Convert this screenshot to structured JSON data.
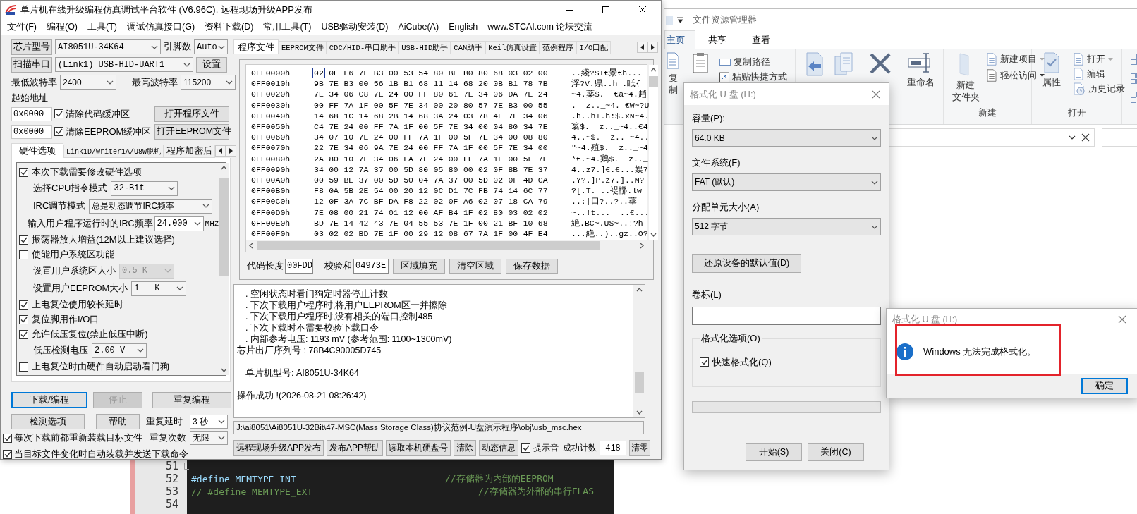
{
  "stc_window": {
    "title": "单片机在线升级编程仿真调试平台软件 (V6.96C), 远程现场升级APP发布",
    "menu": [
      "文件(F)",
      "编程(O)",
      "工具(T)",
      "调试仿真接口(G)",
      "资料下载(D)",
      "常用工具(T)",
      "USB驱动安装(D)",
      "AiCube(A)",
      "English",
      "www.STCAI.com 论坛交流"
    ],
    "chip_row": {
      "button": "芯片型号",
      "chip": "AI8051U-34K64",
      "pins_label": "引脚数",
      "pins": "Auto"
    },
    "port_row": {
      "button": "扫描串口",
      "port": "(Link1) USB-HID-UART1",
      "settings": "设置"
    },
    "baud_row": {
      "min_label": "最低波特率",
      "min": "2400",
      "max_label": "最高波特率",
      "max": "115200"
    },
    "start_address_label": "起始地址",
    "buffers": [
      {
        "address": "0x0000",
        "label": "清除代码缓冲区",
        "checked": true,
        "button": "打开程序文件"
      },
      {
        "address": "0x0000",
        "label": "清除EEPROM缓冲区",
        "checked": true,
        "button": "打开EEPROM文件"
      }
    ],
    "option_tabs": [
      {
        "label": "硬件选项",
        "selected": true
      },
      {
        "label": "Link1D/Writer1A/U8W脱机",
        "selected": false
      },
      {
        "label": "程序加密后",
        "selected": false
      }
    ],
    "hardware_options": [
      {
        "kind": "check",
        "label": "本次下载需要修改硬件选项",
        "checked": true
      },
      {
        "kind": "select",
        "label": "选择CPU指令模式",
        "value": "32-Bit",
        "disabled": false
      },
      {
        "kind": "select",
        "label": "IRC调节模式",
        "value": "总是动态调节IRC频率",
        "disabled": false
      },
      {
        "kind": "input",
        "label": "输入用户程序运行时的IRC频率",
        "value": "24.000",
        "unit": "MHz"
      },
      {
        "kind": "check",
        "label": "振荡器放大增益(12M以上建议选择)",
        "checked": true
      },
      {
        "kind": "check",
        "label": "使能用户系统区功能",
        "checked": false
      },
      {
        "kind": "select",
        "label": "设置用户系统区大小",
        "value": "0.5 K",
        "disabled": true
      },
      {
        "kind": "select",
        "label": "设置用户EEPROM大小",
        "value": "1   K",
        "disabled": false
      },
      {
        "kind": "check",
        "label": "上电复位使用较长延时",
        "checked": true
      },
      {
        "kind": "check",
        "label": "复位脚用作I/O口",
        "checked": true
      },
      {
        "kind": "check",
        "label": "允许低压复位(禁止低压中断)",
        "checked": true
      },
      {
        "kind": "select",
        "label": "低压检测电压",
        "value": "2.00 V",
        "disabled": false
      },
      {
        "kind": "check",
        "label": "上电复位时由硬件自动启动看门狗",
        "checked": false
      }
    ],
    "action_buttons": [
      {
        "label": "下载/编程",
        "focused": true,
        "disabled": false
      },
      {
        "label": "停止",
        "focused": false,
        "disabled": true
      },
      {
        "label": "重复编程",
        "focused": false,
        "disabled": false
      }
    ],
    "detect_button": "检测选项",
    "help_button": "帮助",
    "repeat_delay": {
      "label": "重复延时",
      "value": "3 秒"
    },
    "repeat_count": {
      "label": "重复次数",
      "value": "无限"
    },
    "reload_options": [
      {
        "label": "每次下载前都重新装载目标文件",
        "checked": true
      },
      {
        "label": "当目标文件变化时自动装载并发送下载命令",
        "checked": true
      }
    ],
    "file_tabs": [
      {
        "label": "程序文件",
        "selected": true
      },
      {
        "label": "EEPROM文件",
        "selected": false
      },
      {
        "label": "CDC/HID-串口助手",
        "selected": false
      },
      {
        "label": "USB-HID助手",
        "selected": false
      },
      {
        "label": "CAN助手",
        "selected": false
      },
      {
        "label": "Keil仿真设置",
        "selected": false
      },
      {
        "label": "范例程序",
        "selected": false
      },
      {
        "label": "I/O口配",
        "selected": false
      }
    ],
    "hex_view": {
      "rows": [
        {
          "address": "0FF0000h",
          "bytes": [
            "02",
            "0E",
            "E6",
            "7E",
            "B3",
            "00",
            "53",
            "54",
            "80",
            "BE",
            "B0",
            "80",
            "68",
            "03",
            "02",
            "00"
          ],
          "ascii": "..綫?ST€景€h...",
          "cursor": true
        },
        {
          "address": "0FF0010h",
          "bytes": [
            "9B",
            "7E",
            "B3",
            "00",
            "56",
            "1B",
            "B1",
            "68",
            "11",
            "14",
            "68",
            "20",
            "0B",
            "B1",
            "78",
            "7B"
          ],
          "ascii": "浮?V.県..h .眂{",
          "cursor": false
        },
        {
          "address": "0FF0020h",
          "bytes": [
            "7E",
            "34",
            "06",
            "C8",
            "7E",
            "24",
            "00",
            "FF",
            "80",
            "61",
            "7E",
            "34",
            "06",
            "DA",
            "7E",
            "24"
          ],
          "ascii": "~4.薬$.  €a~4.趙",
          "cursor": false
        },
        {
          "address": "0FF0030h",
          "bytes": [
            "00",
            "FF",
            "7A",
            "1F",
            "00",
            "5F",
            "7E",
            "34",
            "00",
            "20",
            "80",
            "57",
            "7E",
            "B3",
            "00",
            "55"
          ],
          "ascii": ".  z.._~4. €W~?U",
          "cursor": false
        },
        {
          "address": "0FF0040h",
          "bytes": [
            "14",
            "68",
            "1C",
            "14",
            "68",
            "2B",
            "14",
            "68",
            "3A",
            "24",
            "03",
            "78",
            "4E",
            "7E",
            "34",
            "06"
          ],
          "ascii": ".h..h+.h:$.xN~4.",
          "cursor": false
        },
        {
          "address": "0FF0050h",
          "bytes": [
            "C4",
            "7E",
            "24",
            "00",
            "FF",
            "7A",
            "1F",
            "00",
            "5F",
            "7E",
            "34",
            "00",
            "04",
            "80",
            "34",
            "7E"
          ],
          "ascii": "篘$.  z.._~4..€4",
          "cursor": false
        },
        {
          "address": "0FF0060h",
          "bytes": [
            "34",
            "07",
            "10",
            "7E",
            "24",
            "00",
            "FF",
            "7A",
            "1F",
            "00",
            "5F",
            "7E",
            "34",
            "00",
            "08",
            "80"
          ],
          "ascii": "4..~$.  z.._~4..",
          "cursor": false
        },
        {
          "address": "0FF0070h",
          "bytes": [
            "22",
            "7E",
            "34",
            "06",
            "9A",
            "7E",
            "24",
            "00",
            "FF",
            "7A",
            "1F",
            "00",
            "5F",
            "7E",
            "34",
            "00"
          ],
          "ascii": "\"~4.殖$.  z.._~4",
          "cursor": false
        },
        {
          "address": "0FF0080h",
          "bytes": [
            "2A",
            "80",
            "10",
            "7E",
            "34",
            "06",
            "FA",
            "7E",
            "24",
            "00",
            "FF",
            "7A",
            "1F",
            "00",
            "5F",
            "7E"
          ],
          "ascii": "*€.~4.鶏$.  z.._",
          "cursor": false
        },
        {
          "address": "0FF0090h",
          "bytes": [
            "34",
            "00",
            "12",
            "7A",
            "37",
            "00",
            "5D",
            "80",
            "05",
            "80",
            "00",
            "02",
            "0F",
            "8B",
            "7E",
            "37"
          ],
          "ascii": "4..z7.]€.€...娱7",
          "cursor": false
        },
        {
          "address": "0FF00A0h",
          "bytes": [
            "00",
            "59",
            "BE",
            "37",
            "00",
            "5D",
            "50",
            "04",
            "7A",
            "37",
            "00",
            "5D",
            "02",
            "0F",
            "4D",
            "CA"
          ],
          "ascii": ".Y?.]P.z7.]..M?",
          "cursor": false
        },
        {
          "address": "0FF00B0h",
          "bytes": [
            "F8",
            "0A",
            "5B",
            "2E",
            "54",
            "00",
            "20",
            "12",
            "0C",
            "D1",
            "7C",
            "FB",
            "74",
            "14",
            "6C",
            "77"
          ],
          "ascii": "?[.T. ..褆鞹.lw",
          "cursor": false
        },
        {
          "address": "0FF00C0h",
          "bytes": [
            "12",
            "0F",
            "3A",
            "7C",
            "BF",
            "DA",
            "F8",
            "22",
            "02",
            "0F",
            "A6",
            "02",
            "07",
            "18",
            "CA",
            "79"
          ],
          "ascii": "..:|口?..?..蕐",
          "cursor": false
        },
        {
          "address": "0FF00D0h",
          "bytes": [
            "7E",
            "08",
            "00",
            "21",
            "74",
            "01",
            "12",
            "00",
            "AF",
            "B4",
            "1F",
            "02",
            "80",
            "03",
            "02",
            "02"
          ],
          "ascii": "~..!t...  ..€...",
          "cursor": false
        },
        {
          "address": "0FF00E0h",
          "bytes": [
            "BD",
            "7E",
            "14",
            "42",
            "43",
            "7E",
            "04",
            "55",
            "53",
            "7E",
            "1F",
            "00",
            "21",
            "BF",
            "10",
            "68"
          ],
          "ascii": "絶.BC~.US~..!?h",
          "cursor": false
        },
        {
          "address": "0FF00F0h",
          "bytes": [
            "03",
            "02",
            "02",
            "BD",
            "7E",
            "1F",
            "00",
            "29",
            "12",
            "08",
            "67",
            "7A",
            "1F",
            "00",
            "4F",
            "E4"
          ],
          "ascii": "...絶..)..gz..O?",
          "cursor": false
        }
      ],
      "code_length_label": "代码长度",
      "code_length": "00FDD",
      "checksum_label": "校验和",
      "checksum": "04973E",
      "buttons": [
        "区域填充",
        "清空区域",
        "保存数据"
      ]
    },
    "log": [
      {
        "kind": "bullet",
        "text": ". 空闲状态时看门狗定时器停止计数"
      },
      {
        "kind": "bullet",
        "text": ". 下次下载用户程序时,将用户EEPROM区一并擦除"
      },
      {
        "kind": "bullet",
        "text": ". 下次下载用户程序时,没有相关的端口控制485"
      },
      {
        "kind": "bullet",
        "text": ". 下次下载时不需要校验下载口令"
      },
      {
        "kind": "bullet",
        "text": ". 内部参考电压: 1193 mV (参考范围: 1100~1300mV)"
      },
      {
        "kind": "plain",
        "text": "芯片出厂序列号 : 78B4C90005D745"
      },
      {
        "kind": "spaced_indent",
        "text": "单片机型号: AI8051U-34K64"
      },
      {
        "kind": "spaced",
        "text": "操作成功 !(2026-08-21 08:26:42)"
      }
    ],
    "file_path": "J:\\ai8051\\Ai8051U-32Bit\\47-MSC(Mass Storage Class)协议范例-U盘演示程序\\obj\\usb_msc.hex",
    "bottom_buttons": [
      "远程现场升级APP发布",
      "发布APP帮助",
      "读取本机硬盘号",
      "清除",
      "动态信息"
    ],
    "beep": {
      "label": "提示音",
      "checked": true
    },
    "success_count": {
      "label": "成功计数",
      "value": "418"
    },
    "reset_button": "清零"
  },
  "explorer": {
    "title": "文件资源管理器",
    "tabs": [
      {
        "label": "主页",
        "selected": true
      },
      {
        "label": "共享",
        "selected": false
      },
      {
        "label": "查看",
        "selected": false
      }
    ],
    "ribbon": {
      "copy": "复制",
      "copy_path": "复制路径",
      "paste_shortcut": "粘贴快捷方式",
      "rename": "重命名",
      "new_folder": [
        "新建",
        "文件夹"
      ],
      "new_item": "新建项目",
      "easy_access": "轻松访问",
      "new_group": "新建",
      "properties": "属性",
      "open": "打开",
      "edit": "编辑",
      "history": "历史记录",
      "open_group": "打开"
    }
  },
  "code_editor": {
    "lines": [
      {
        "number": "51",
        "kind": "fold"
      },
      {
        "number": "52",
        "kind": "define",
        "code": "#define MEMTYPE_INT",
        "comment": "//存储器为内部的EEPROM"
      },
      {
        "number": "53",
        "kind": "commented",
        "code": "// #define MEMTYPE_EXT",
        "comment": "//存储器为外部的串行FLAS"
      },
      {
        "number": "54",
        "kind": "blank"
      }
    ]
  },
  "format_dialog": {
    "title": "格式化 U 盘 (H:)",
    "capacity_label": "容量(P):",
    "capacity": "64.0 KB",
    "fs_label": "文件系统(F)",
    "fs": "FAT (默认)",
    "unit_label": "分配单元大小(A)",
    "unit": "512 字节",
    "restore_button": "还原设备的默认值(D)",
    "volume_label": "卷标(L)",
    "options_label": "格式化选项(O)",
    "quick": {
      "label": "快速格式化(Q)",
      "checked": true
    },
    "progress": {
      "level": 0
    },
    "start_button": "开始(S)",
    "close_button": "关闭(C)"
  },
  "message_box": {
    "title": "格式化 U 盘 (H:)",
    "message": "Windows 无法完成格式化。",
    "button": "确定"
  }
}
